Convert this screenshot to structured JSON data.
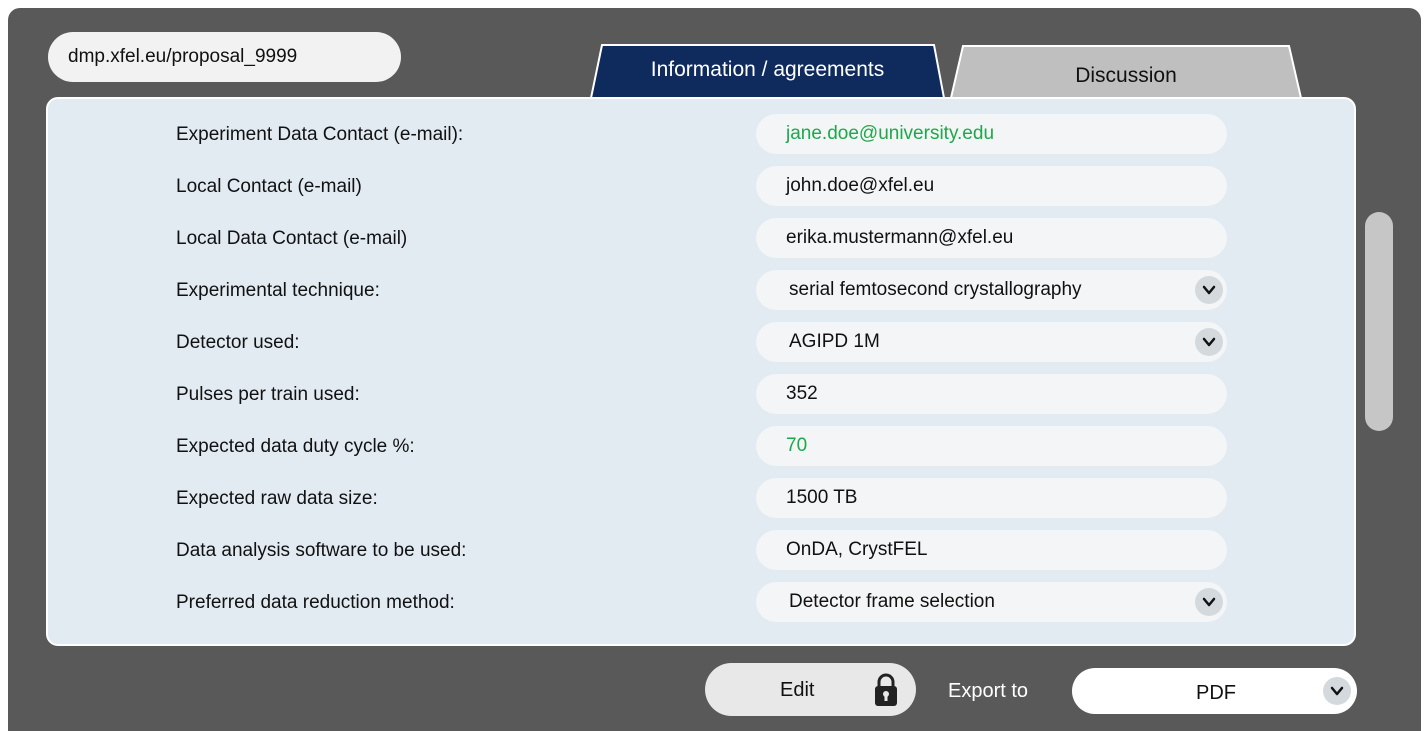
{
  "url": "dmp.xfel.eu/proposal_9999",
  "tabs": [
    {
      "label": "Information / agreements",
      "active": true
    },
    {
      "label": "Discussion",
      "active": false
    }
  ],
  "colors": {
    "frame": "#595959",
    "active_tab": "#0f2a5c",
    "inactive_tab": "#bfbfbf",
    "panel": "#e2eaf2",
    "highlight_text": "#1ea84a"
  },
  "form": {
    "fields": [
      {
        "label": "Experiment Data Contact (e-mail):",
        "value": "jane.doe@university.edu",
        "type": "text",
        "highlight": true
      },
      {
        "label": "Local Contact (e-mail)",
        "value": "john.doe@xfel.eu",
        "type": "text",
        "highlight": false
      },
      {
        "label": "Local Data Contact (e-mail)",
        "value": "erika.mustermann@xfel.eu",
        "type": "text",
        "highlight": false
      },
      {
        "label": "Experimental technique:",
        "value": "serial femtosecond crystallography",
        "type": "select",
        "highlight": false
      },
      {
        "label": "Detector used:",
        "value": "AGIPD 1M",
        "type": "select",
        "highlight": false
      },
      {
        "label": "Pulses per train used:",
        "value": "352",
        "type": "text",
        "highlight": false
      },
      {
        "label": "Expected data duty cycle %:",
        "value": "70",
        "type": "text",
        "highlight": true
      },
      {
        "label": "Expected raw data size:",
        "value": "1500 TB",
        "type": "text",
        "highlight": false
      },
      {
        "label": "Data analysis software to be used:",
        "value": "OnDA, CrystFEL",
        "type": "text",
        "highlight": false
      },
      {
        "label": "Preferred data reduction method:",
        "value": "Detector frame selection",
        "type": "select",
        "highlight": false
      }
    ]
  },
  "footer": {
    "edit_label": "Edit",
    "lock_icon": "lock-icon",
    "export_label": "Export to",
    "export_value": "PDF"
  }
}
